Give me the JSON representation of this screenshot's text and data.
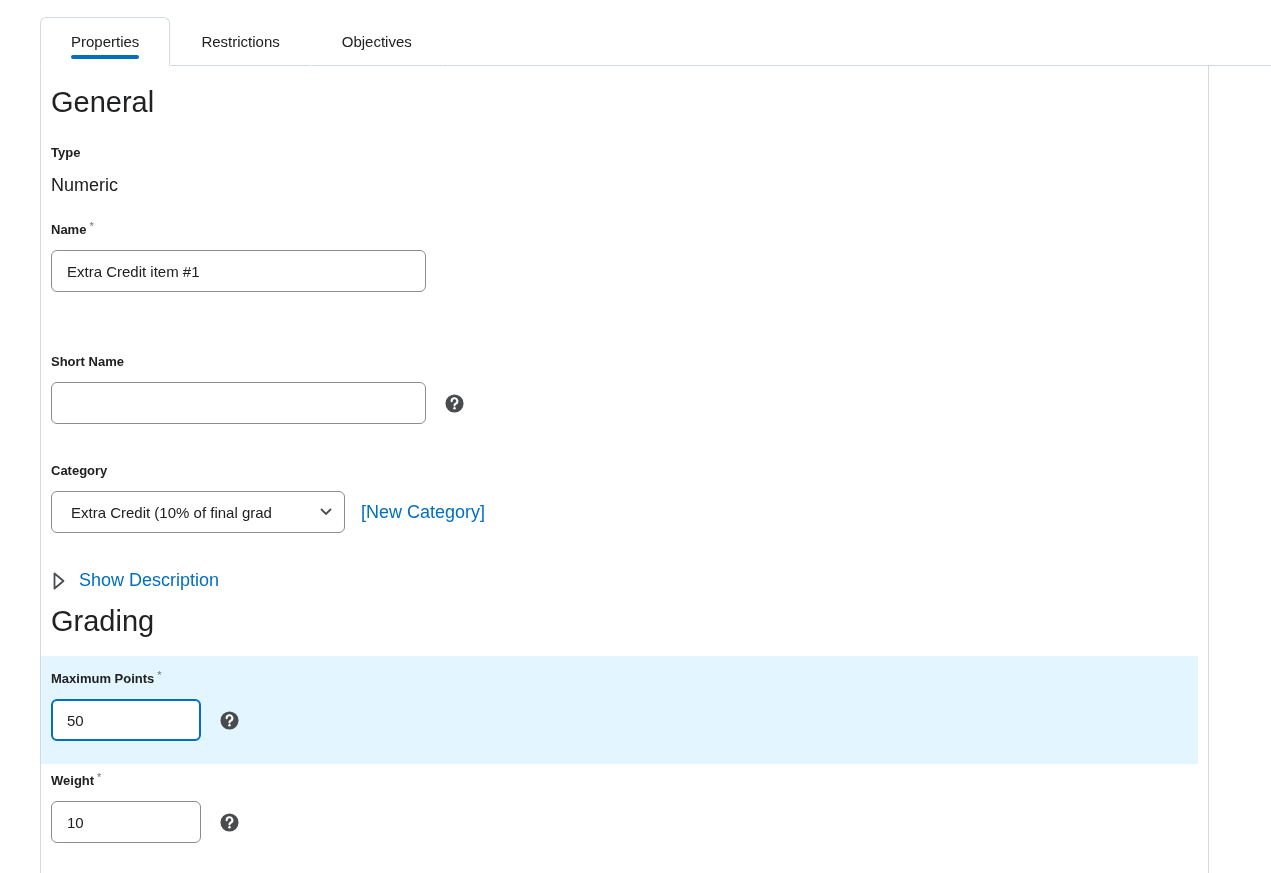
{
  "tabs": [
    {
      "label": "Properties",
      "selected": true
    },
    {
      "label": "Restrictions",
      "selected": false
    },
    {
      "label": "Objectives",
      "selected": false
    }
  ],
  "sections": [
    {
      "heading": "General",
      "fields": [
        {
          "kind": "static",
          "label": "Type",
          "value": "Numeric"
        },
        {
          "kind": "text",
          "label": "Name",
          "required_mark": "*",
          "value": "Extra Credit item #1",
          "focused": false
        },
        {
          "kind": "text",
          "label": "Short Name",
          "help": true,
          "focused": false
        },
        {
          "kind": "select",
          "label": "Category",
          "value": "Extra Credit (10% of final grad",
          "link": "[New Category]"
        },
        {
          "kind": "disclosure",
          "label": "Show Description",
          "expanded": false
        }
      ]
    },
    {
      "heading": "Grading",
      "fields": [
        {
          "kind": "number",
          "label": "Maximum Points",
          "required_mark": "*",
          "value": "50",
          "help": true,
          "focused": true
        },
        {
          "kind": "number",
          "label": "Weight",
          "required_mark": "*",
          "value": "10",
          "help": true,
          "focused": false
        }
      ]
    }
  ]
}
